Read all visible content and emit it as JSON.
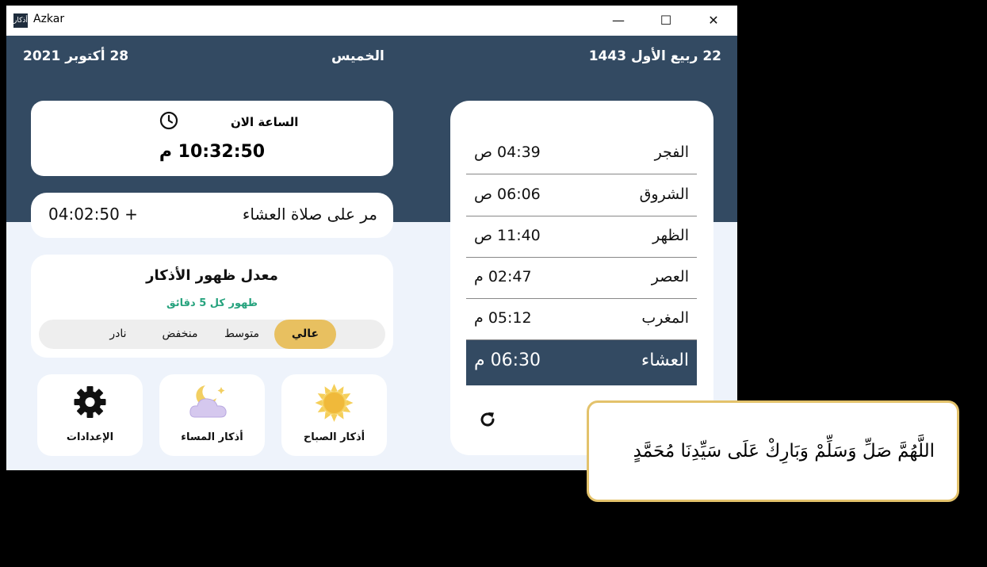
{
  "window": {
    "app_icon_text": "أذكار",
    "title": "Azkar",
    "min_label": "—",
    "max_label": "☐",
    "close_label": "✕"
  },
  "header": {
    "gregorian_date": "28 أكتوبر 2021",
    "day": "الخميس",
    "hijri_date": "22 ربيع الأول 1443"
  },
  "clock": {
    "label": "الساعة الان",
    "time": "10:32:50 م",
    "icon": "clock-icon"
  },
  "elapsed": {
    "label": "مر على صلاة العشاء",
    "value": "04:02:50 +"
  },
  "frequency": {
    "title": "معدل ظهور الأذكار",
    "subtitle": "ظهور كل 5 دقائق",
    "options": [
      "عالي",
      "متوسط",
      "منخفض",
      "نادر"
    ],
    "selected": "عالي"
  },
  "tiles": {
    "settings": {
      "label": "الإعدادات",
      "icon": "gear-icon"
    },
    "evening": {
      "label": "أذكار المساء",
      "icon": "moon-cloud-icon"
    },
    "morning": {
      "label": "أذكار الصباح",
      "icon": "sun-icon"
    }
  },
  "prayers": [
    {
      "name": "الفجر",
      "time": "04:39 ص"
    },
    {
      "name": "الشروق",
      "time": "06:06 ص"
    },
    {
      "name": "الظهر",
      "time": "11:40 ص"
    },
    {
      "name": "العصر",
      "time": "02:47 م"
    },
    {
      "name": "المغرب",
      "time": "05:12 م"
    },
    {
      "name": "العشاء",
      "time": "06:30 م"
    }
  ],
  "active_prayer": "العشاء",
  "popup": {
    "text": "اللَّهُمَّ صَلِّ وَسَلِّمْ وَبَارِكْ عَلَى سَيِّدِنَا مُحَمَّدٍ"
  },
  "colors": {
    "header": "#334a62",
    "accent": "#e8c060",
    "subtitle_green": "#27a37e",
    "popup_border": "#e3c26b"
  }
}
